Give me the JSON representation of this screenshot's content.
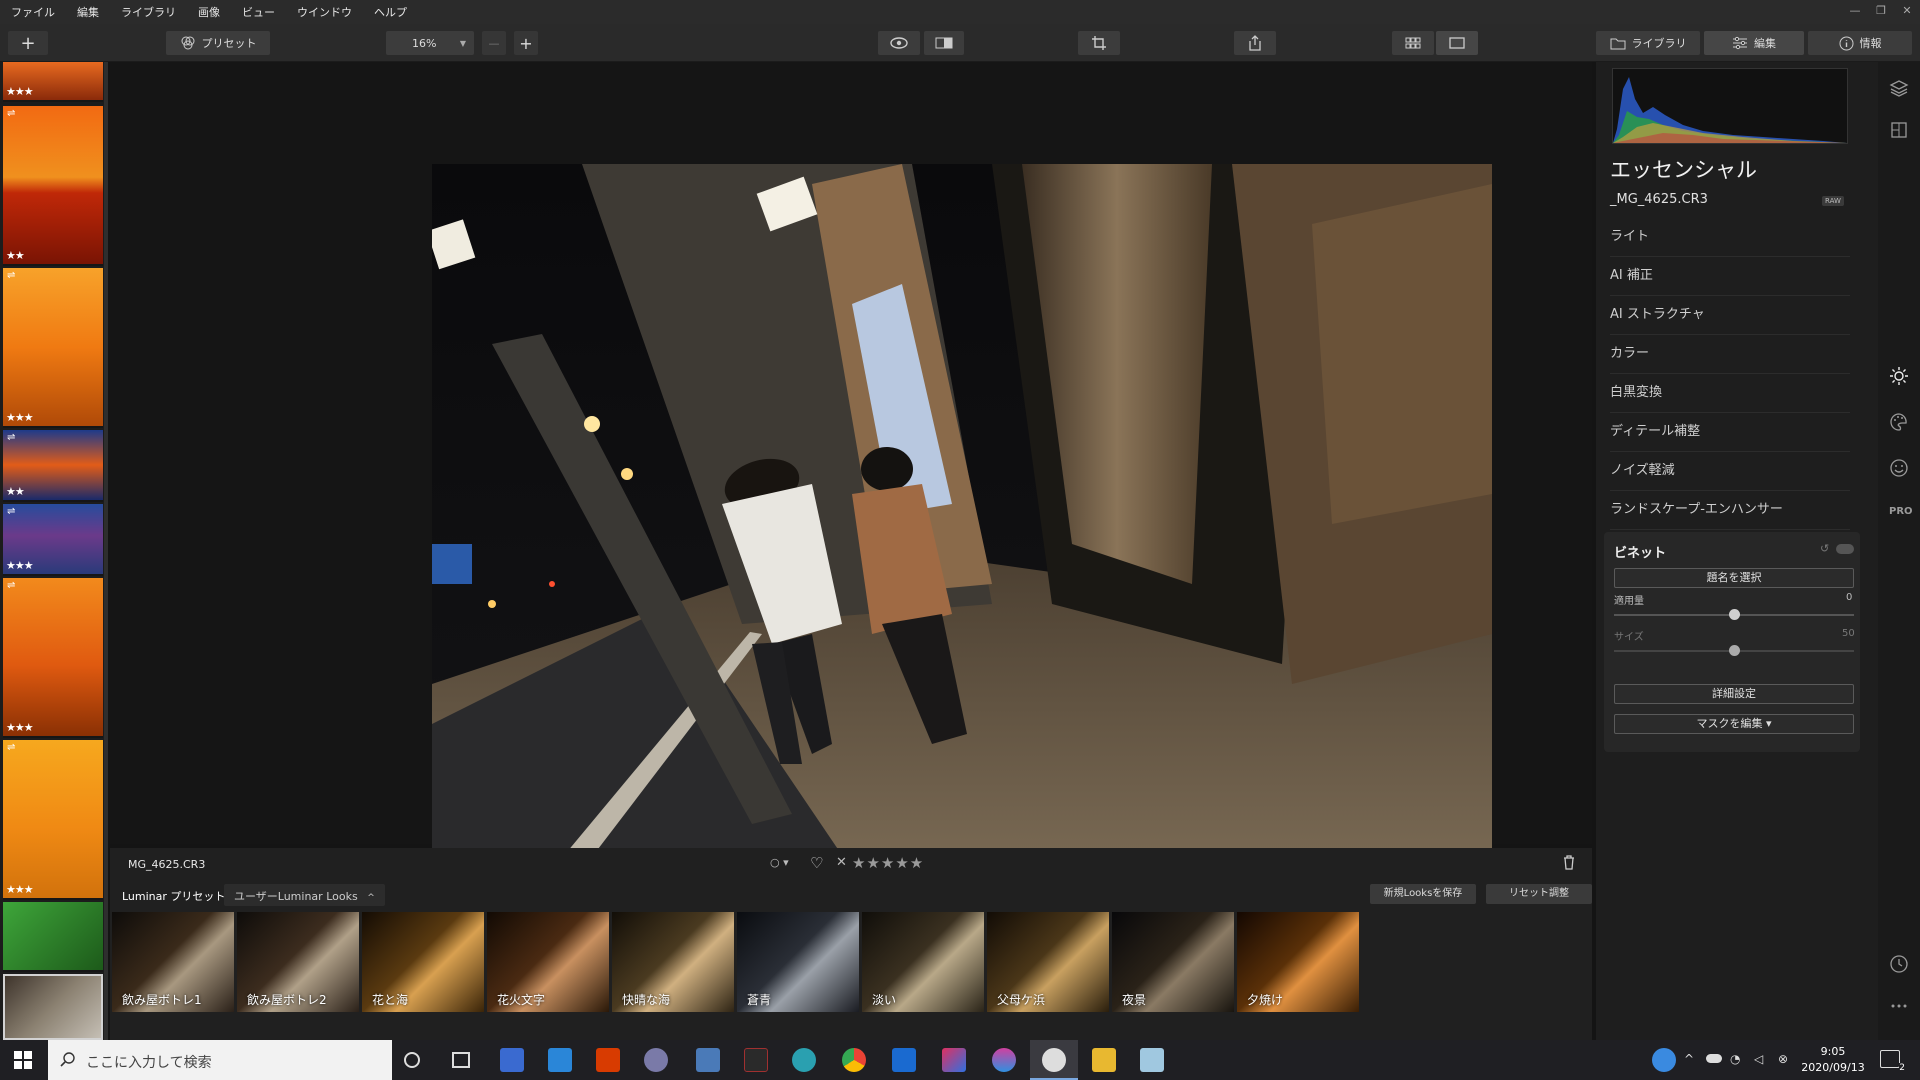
{
  "menu": [
    "ファイル",
    "編集",
    "ライブラリ",
    "画像",
    "ビュー",
    "ウインドウ",
    "ヘルプ"
  ],
  "window_controls": [
    "—",
    "❐",
    "✕"
  ],
  "toolbar": {
    "add_symbol": "+",
    "preset_label": "プリセット",
    "zoom_value": "16%",
    "zoom_minus": "—",
    "zoom_plus": "+",
    "tabs": [
      "ライブラリ",
      "編集",
      "情報"
    ]
  },
  "thumbnails": [
    {
      "rating": "★★★",
      "edited": false,
      "colors": [
        "#e86a20",
        "#8a2a0a"
      ]
    },
    {
      "rating": "★★",
      "edited": true,
      "colors": [
        "#f26a12",
        "#c02808"
      ]
    },
    {
      "rating": "★★★",
      "edited": true,
      "colors": [
        "#f7a22a",
        "#b04a08"
      ]
    },
    {
      "rating": "★★",
      "edited": true,
      "colors": [
        "#1e3a8a",
        "#e25c18"
      ]
    },
    {
      "rating": "★★★",
      "edited": true,
      "colors": [
        "#274c9c",
        "#6b3a8a"
      ]
    },
    {
      "rating": "★★★",
      "edited": true,
      "colors": [
        "#f28a1c",
        "#8a3004"
      ]
    },
    {
      "rating": "★★★",
      "edited": true,
      "colors": [
        "#f6a81e",
        "#d2720c"
      ]
    },
    {
      "rating": "",
      "edited": false,
      "colors": [
        "#3ea63a",
        "#1d5a1a"
      ]
    },
    {
      "rating": "",
      "edited": false,
      "colors": [
        "#3a3028",
        "#c6c0b6"
      ]
    }
  ],
  "info_bar": {
    "filename": "MG_4625.CR3",
    "flag_symbol": "○ ▾",
    "heart": "♡",
    "reject": "✕",
    "stars": "★★★★★",
    "trash": "🗑"
  },
  "presets_bar": {
    "title": "Luminar プリセット",
    "category": "ユーザーLuminar Looks",
    "category_chevron": "^",
    "save_button": "新規Looksを保存",
    "reset_button": "リセット調整"
  },
  "presets": [
    {
      "label": "飲み屋ボトレ1",
      "tint": "#3a2a1a"
    },
    {
      "label": "飲み屋ボトレ2",
      "tint": "#3c2c1e"
    },
    {
      "label": "花と海",
      "tint": "#5a3a10"
    },
    {
      "label": "花火文字",
      "tint": "#4a2a12"
    },
    {
      "label": "快晴な海",
      "tint": "#4a3a20"
    },
    {
      "label": "蒼青",
      "tint": "#2a2e36"
    },
    {
      "label": "淡い",
      "tint": "#3a3020"
    },
    {
      "label": "父母ケ浜",
      "tint": "#4a3618"
    },
    {
      "label": "夜景",
      "tint": "#2a2218"
    },
    {
      "label": "夕焼け",
      "tint": "#5a3008"
    }
  ],
  "right_panel": {
    "title": "エッセンシャル",
    "filename": "_MG_4625.CR3",
    "raw_badge": "RAW",
    "sections": [
      "ライト",
      "AI 補正",
      "AI ストラクチャ",
      "カラー",
      "白黒変換",
      "ディテール補整",
      "ノイズ軽減",
      "ランドスケープ-エンハンサー"
    ],
    "vignette": {
      "title": "ビネット",
      "select_subject": "題名を選択",
      "amount_label": "適用量",
      "amount_value": "0",
      "size_label": "サイズ",
      "size_value": "50",
      "advanced": "詳細設定",
      "edit_mask": "マスクを編集 ▾"
    }
  },
  "rail_icons": [
    "layers-icon",
    "canvas-icon",
    "sun-icon",
    "palette-icon",
    "face-icon",
    "pro-icon",
    "history-icon",
    "more-icon"
  ],
  "rail_pro_label": "PRO",
  "taskbar": {
    "search_placeholder": "ここに入力して検索",
    "time": "9:05",
    "date": "2020/09/13",
    "notification_count": "2"
  },
  "colors": {
    "accent": "#3c3c3c",
    "panel": "#1e1e1e"
  }
}
